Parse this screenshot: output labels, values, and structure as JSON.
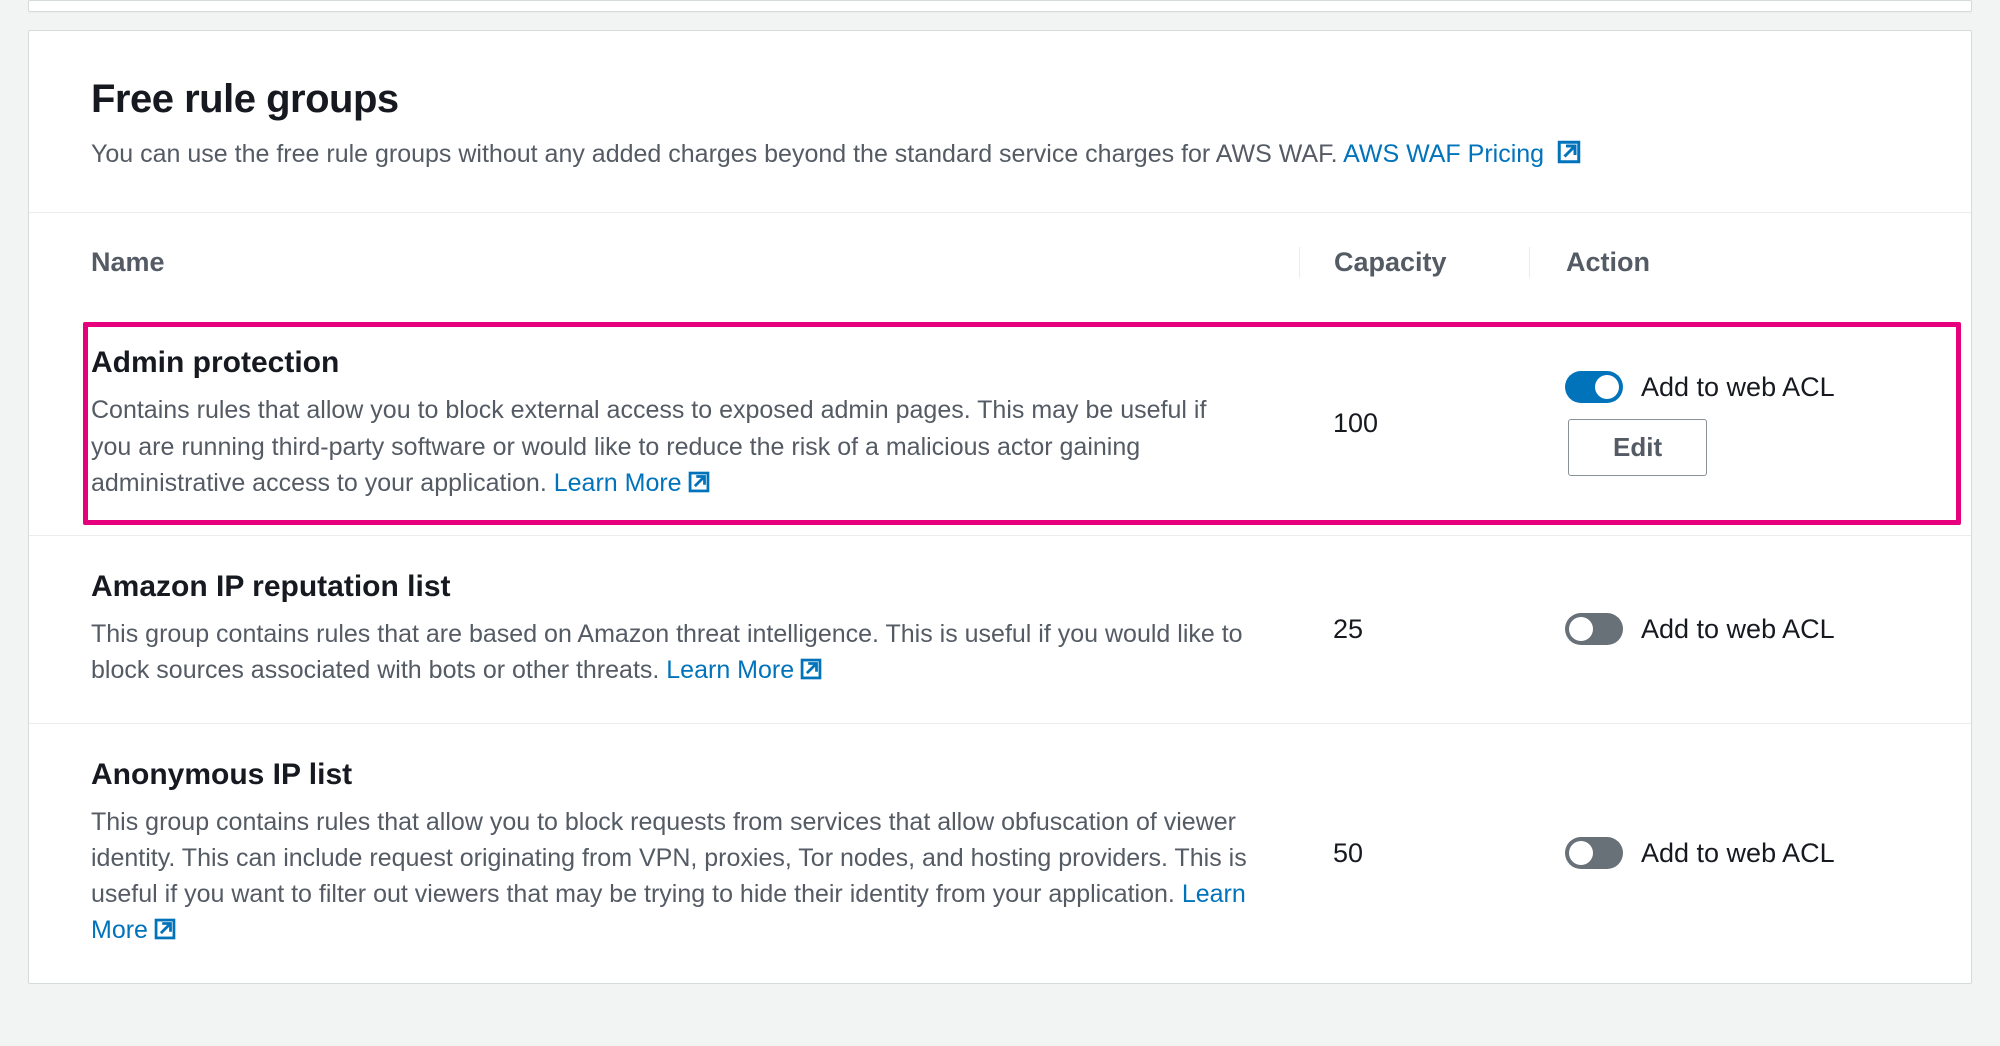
{
  "header": {
    "title": "Free rule groups",
    "description": "You can use the free rule groups without any added charges beyond the standard service charges for AWS WAF. ",
    "pricing_link_text": "AWS WAF Pricing"
  },
  "columns": {
    "name": "Name",
    "capacity": "Capacity",
    "action": "Action"
  },
  "toggle_label": "Add to web ACL",
  "edit_label": "Edit",
  "learn_more": "Learn More",
  "rules": [
    {
      "name": "Admin protection",
      "description": "Contains rules that allow you to block external access to exposed admin pages. This may be useful if you are running third-party software or would like to reduce the risk of a malicious actor gaining administrative access to your application.  ",
      "capacity": "100",
      "enabled": true,
      "highlighted": true
    },
    {
      "name": "Amazon IP reputation list",
      "description": "This group contains rules that are based on Amazon threat intelligence. This is useful if you would like to block sources associated with bots or other threats.  ",
      "capacity": "25",
      "enabled": false,
      "highlighted": false
    },
    {
      "name": "Anonymous IP list",
      "description": "This group contains rules that allow you to block requests from services that allow obfuscation of viewer identity. This can include request originating from VPN, proxies, Tor nodes, and hosting providers. This is useful if you want to filter out viewers that may be trying to hide their identity from your application.  ",
      "capacity": "50",
      "enabled": false,
      "highlighted": false
    }
  ]
}
